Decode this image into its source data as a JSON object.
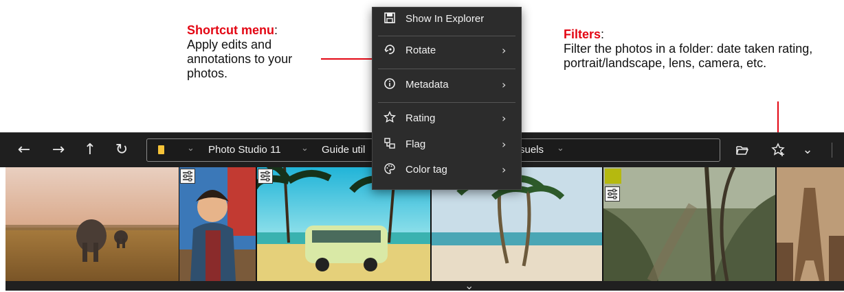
{
  "annotations": {
    "shortcut": {
      "title": "Shortcut menu",
      "suffix": ":",
      "text": "Apply edits and annotations to your photos."
    },
    "filters": {
      "title": "Filters",
      "suffix": ":",
      "text": "Filter the photos in a folder: date taken rating, portrait/landscape, lens, camera, etc."
    },
    "accent_color": "#e30613"
  },
  "toolbar": {
    "back_icon": "←",
    "forward_icon": "→",
    "up_icon": "↑",
    "refresh_icon": "↻",
    "breadcrumb": [
      "Photo Studio 11",
      "Guide util",
      "suels"
    ],
    "open_folder_icon": "folder-open-icon",
    "filter_icon": "star-filter-icon",
    "dropdown_icon": "⌄"
  },
  "context_menu": {
    "items": [
      {
        "icon": "save-icon",
        "label": "Show In Explorer",
        "submenu": false
      },
      {
        "icon": "rotate-icon",
        "label": "Rotate",
        "submenu": true
      },
      {
        "icon": "info-icon",
        "label": "Metadata",
        "submenu": true
      },
      {
        "icon": "star-icon",
        "label": "Rating",
        "submenu": true
      },
      {
        "icon": "flag-icon",
        "label": "Flag",
        "submenu": true
      },
      {
        "icon": "palette-icon",
        "label": "Color tag",
        "submenu": true
      }
    ],
    "submenu_arrow": "›"
  },
  "filmstrip": {
    "thumbnails": [
      {
        "subject": "elephants in savanna",
        "edited": false,
        "color_tag": null
      },
      {
        "subject": "child in jacket",
        "edited": true,
        "color_tag": null
      },
      {
        "subject": "van under palm trees",
        "edited": true,
        "color_tag": null,
        "selected": true
      },
      {
        "subject": "palm trees on beach",
        "edited": false,
        "color_tag": null
      },
      {
        "subject": "forest path",
        "edited": true,
        "color_tag": "#b5b90f"
      },
      {
        "subject": "eiffel tower",
        "edited": false,
        "color_tag": null
      }
    ],
    "expand_icon": "chevron-down-icon"
  }
}
